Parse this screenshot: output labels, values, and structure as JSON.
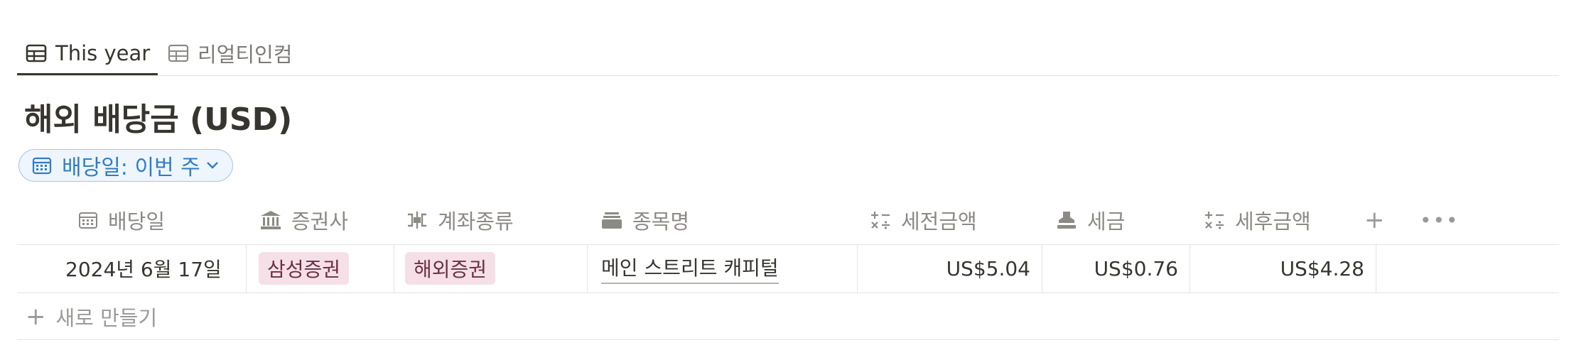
{
  "tabs": [
    {
      "label": "This year",
      "icon": "table-icon",
      "active": true
    },
    {
      "label": "리얼티인컴",
      "icon": "table-icon",
      "active": false
    }
  ],
  "title": "해외 배당금 (USD)",
  "filter": {
    "label": "배당일: 이번 주",
    "icon": "calendar-icon"
  },
  "columns": [
    {
      "label": "배당일",
      "icon": "calendar-icon"
    },
    {
      "label": "증권사",
      "icon": "bank-icon"
    },
    {
      "label": "계좌종류",
      "icon": "account-type-icon"
    },
    {
      "label": "종목명",
      "icon": "stack-icon"
    },
    {
      "label": "세전금액",
      "icon": "formula-icon"
    },
    {
      "label": "세금",
      "icon": "stamp-icon"
    },
    {
      "label": "세후금액",
      "icon": "formula-icon"
    }
  ],
  "rows": [
    {
      "date": "2024년 6월 17일",
      "broker": "삼성증권",
      "account_type": "해외증권",
      "stock": "메인 스트리트 캐피털",
      "pretax": "US$5.04",
      "tax": "US$0.76",
      "aftertax": "US$4.28"
    }
  ],
  "new_row_label": "새로 만들기",
  "colors": {
    "accent": "#2f7dc5",
    "tag_bg": "#f6e0e8",
    "text": "#37352f",
    "muted": "#8c8a85"
  }
}
